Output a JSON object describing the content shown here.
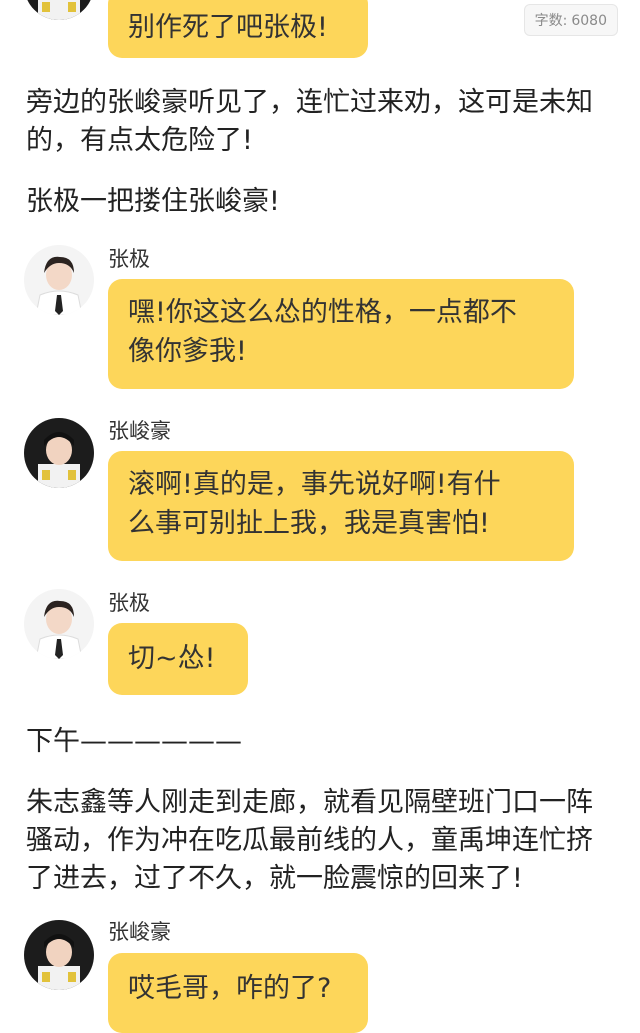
{
  "word_count": {
    "label": "字数:",
    "value": "6080"
  },
  "items": {
    "bubble_top": "别作死了吧张极!",
    "para1_line1": "旁边的张峻豪听见了，连忙过来劝，这可是未知",
    "para1_line2": "的，有点太危险了!",
    "para2": "张极一把搂住张峻豪!",
    "msg1": {
      "sender": "张极",
      "line1": "嘿!你这这么怂的性格，一点都不",
      "line2": "像你爹我!"
    },
    "msg2": {
      "sender": "张峻豪",
      "line1": "滚啊!真的是，事先说好啊!有什",
      "line2": "么事可别扯上我，我是真害怕!"
    },
    "msg3": {
      "sender": "张极",
      "line1": "切~怂!"
    },
    "para3": "下午——————",
    "para4_line1": "朱志鑫等人刚走到走廊，就看见隔壁班门口一阵",
    "para4_line2": "骚动，作为冲在吃瓜最前线的人，童禹坤连忙挤",
    "para4_line3": "了进去，过了不久，就一脸震惊的回来了!",
    "msg4": {
      "sender": "张峻豪",
      "line1": "哎毛哥，咋的了?"
    }
  },
  "colors": {
    "bubble": "#fdd65a",
    "text": "#222222",
    "badge_bg": "#f7f7f7"
  },
  "icons": {
    "avatar_zhangji": "boy-avatar-white-bg",
    "avatar_zhangjunhao": "boy-avatar-dark-bg"
  }
}
